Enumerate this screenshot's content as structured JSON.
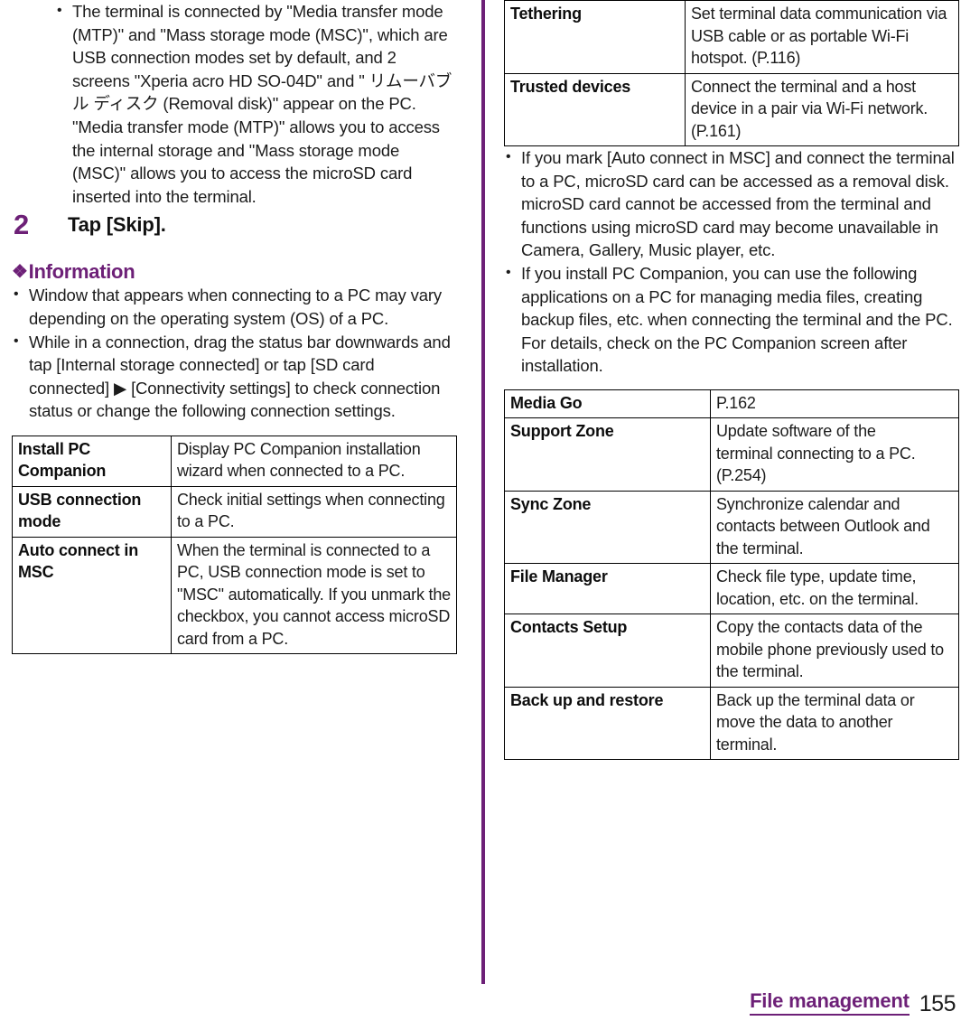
{
  "page": {
    "number": "155",
    "chapter": "File management",
    "accent_color": "#6d2077",
    "text_color": "#1c1c1c"
  },
  "left_column": {
    "intro_bullets": [
      "The terminal is connected by \"Media transfer mode (MTP)\" and \"Mass storage mode (MSC)\", which are USB connection modes set by default, and 2 screens \"Xperia acro HD SO-04D\" and \" リムーバブル ディスク (Removal disk)\" appear on the PC. \"Media transfer mode (MTP)\" allows you to access the internal storage and \"Mass storage mode (MSC)\" allows you to access the microSD card inserted into the terminal."
    ],
    "step": {
      "number": "2",
      "title": "Tap [Skip]."
    },
    "information": {
      "diamond_icon": "❖",
      "heading": "Information",
      "bullets": [
        "Window that appears when connecting to a PC may vary depending on the operating system (OS) of a PC.",
        "While in a connection, drag the status bar downwards and tap [Internal storage connected] or tap [SD card connected] ▶ [Connectivity settings] to check connection status or change the following connection settings."
      ]
    },
    "settings_table": {
      "rows": [
        {
          "label": "Install PC Companion",
          "description": "Display PC Companion installation wizard when connected to a PC."
        },
        {
          "label": "USB connection mode",
          "description": "Check initial settings when connecting to a PC."
        },
        {
          "label": "Auto connect in MSC",
          "description": "When the terminal is connected to a PC, USB connection mode is set to \"MSC\" automatically. If you unmark the checkbox, you cannot access microSD card from a PC."
        }
      ]
    }
  },
  "right_column": {
    "settings_table_continued": {
      "rows": [
        {
          "label": "Tethering",
          "description": "Set terminal data communication via USB cable or as portable Wi-Fi hotspot. (P.116)"
        },
        {
          "label": "Trusted devices",
          "description": "Connect the terminal and a host device in a pair via Wi-Fi network. (P.161)"
        }
      ]
    },
    "bullets": [
      "If you mark [Auto connect in MSC] and connect the terminal to a PC, microSD card can be accessed as a removal disk. microSD card cannot be accessed from the terminal and functions using microSD card may become unavailable in Camera, Gallery, Music player, etc.",
      "If you install PC Companion, you can use the following applications on a PC for managing media files, creating backup files, etc. when connecting the terminal and the PC. For details, check on the PC Companion screen after installation."
    ],
    "apps_table": {
      "rows": [
        {
          "label": "Media Go",
          "description": "P.162"
        },
        {
          "label": "Support Zone",
          "description": "Update software of the\nterminal connecting to a PC. (P.254)"
        },
        {
          "label": "Sync Zone",
          "description": "Synchronize calendar and contacts between Outlook and the terminal."
        },
        {
          "label": "File Manager",
          "description": "Check file type, update time, location, etc. on the terminal."
        },
        {
          "label": "Contacts Setup",
          "description": "Copy the contacts data of the mobile phone previously used to the terminal."
        },
        {
          "label": "Back up and restore",
          "description": "Back up the terminal data or move the data to another terminal."
        }
      ]
    }
  }
}
